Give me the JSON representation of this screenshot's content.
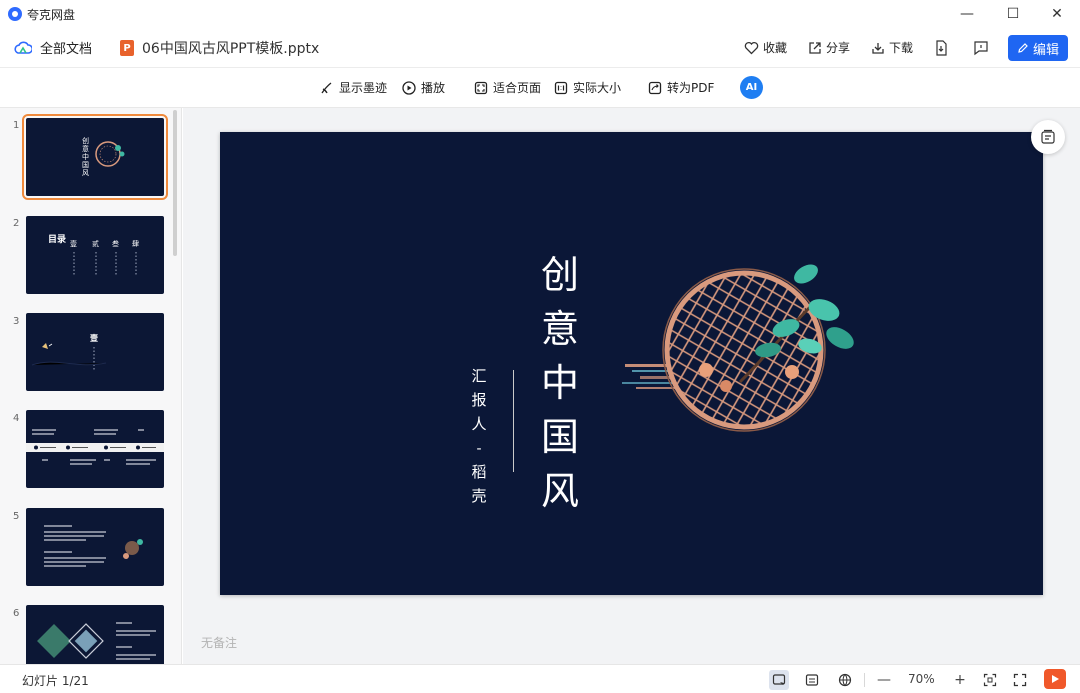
{
  "app": {
    "title": "夸克网盘"
  },
  "window": {
    "minimize": "—",
    "maximize": "☐",
    "close": "✕"
  },
  "header": {
    "all_docs": "全部文档",
    "file_name": "06中国风古风PPT模板.pptx",
    "file_badge": "P",
    "favorite": "收藏",
    "share": "分享",
    "download": "下载",
    "edit": "编辑"
  },
  "toolbar": {
    "show_ink": "显示墨迹",
    "play": "播放",
    "fit_page": "适合页面",
    "actual_size": "实际大小",
    "to_pdf": "转为PDF",
    "ai_label": "AI"
  },
  "sidebar": {
    "thumbnails": [
      {
        "num": "1",
        "active": true
      },
      {
        "num": "2",
        "active": false
      },
      {
        "num": "3",
        "active": false
      },
      {
        "num": "4",
        "active": false
      },
      {
        "num": "5",
        "active": false
      },
      {
        "num": "6",
        "active": false
      }
    ],
    "thumb2": {
      "toc": "目录",
      "items": [
        "壹",
        "贰",
        "叁",
        "肆"
      ]
    },
    "thumb3": {
      "chapter": "壹"
    }
  },
  "slide": {
    "title": "创意中国风",
    "reporter": "汇报人-稻壳",
    "bg_color": "#0b1737",
    "accent": "#d99a7e"
  },
  "notes": {
    "placeholder": "无备注"
  },
  "status": {
    "slide_count": "幻灯片 1/21",
    "zoom_out": "—",
    "zoom": "70%",
    "zoom_in": "+"
  }
}
